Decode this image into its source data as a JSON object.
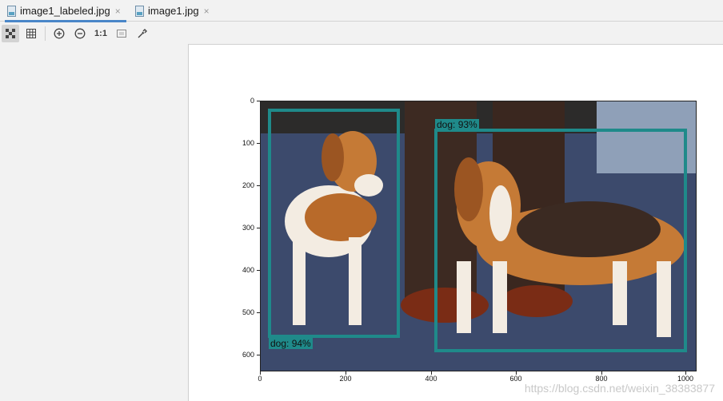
{
  "tabs": [
    {
      "label": "image1_labeled.jpg",
      "close": "×",
      "active": true
    },
    {
      "label": "image1.jpg",
      "close": "×",
      "active": false
    }
  ],
  "toolbar": {
    "icons": [
      "checker-icon",
      "grid-icon",
      "zoom-in-icon",
      "zoom-out-icon",
      "actual-size-icon",
      "fit-icon",
      "eyedropper-icon"
    ],
    "actual_size_label": "1:1"
  },
  "figure": {
    "y_ticks": [
      "0",
      "100",
      "200",
      "300",
      "400",
      "500",
      "600"
    ],
    "x_ticks": [
      "0",
      "200",
      "400",
      "600",
      "800",
      "1000"
    ],
    "detections": [
      {
        "label": "dog: 94%",
        "color": "#1f8a8a"
      },
      {
        "label": "dog: 93%",
        "color": "#1f8a8a"
      }
    ]
  },
  "watermark": "https://blog.csdn.net/weixin_38383877"
}
